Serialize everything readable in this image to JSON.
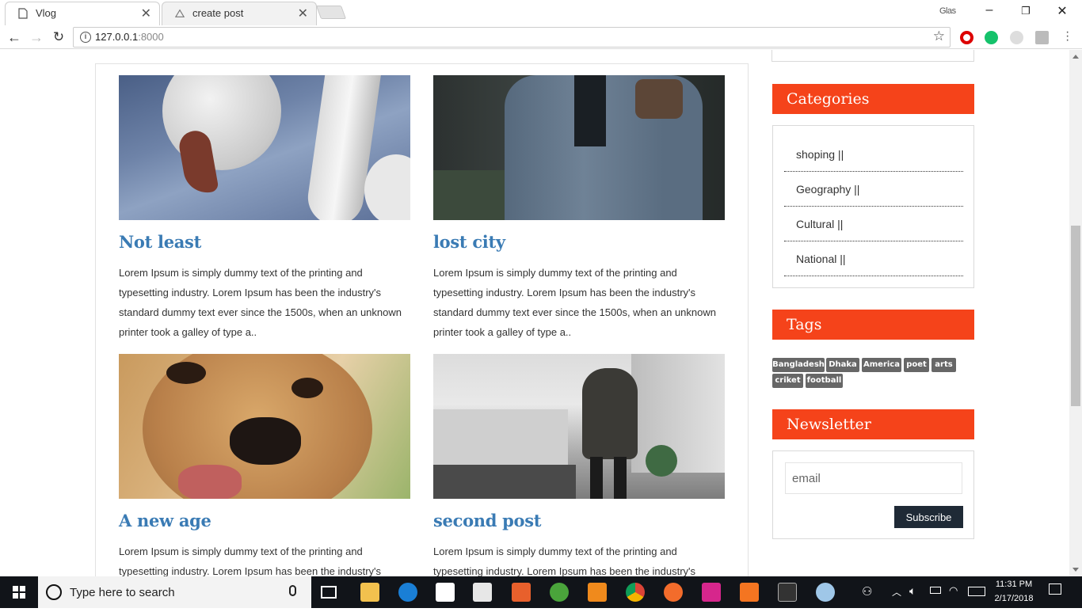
{
  "browser": {
    "tabs": [
      {
        "label": "Vlog",
        "active": true
      },
      {
        "label": "create post",
        "active": false
      }
    ],
    "profile_name": "Glas",
    "url_host": "127.0.0.1",
    "url_port": ":8000"
  },
  "posts": [
    {
      "title": "Not least",
      "image": "swan-photo",
      "excerpt": "Lorem Ipsum is simply dummy text of the printing and typesetting industry. Lorem Ipsum has been the industry's standard dummy text ever since the 1500s, when an unknown printer took a galley of type a.."
    },
    {
      "title": "lost city",
      "image": "jacket-photo",
      "excerpt": "Lorem Ipsum is simply dummy text of the printing and typesetting industry. Lorem Ipsum has been the industry's standard dummy text ever since the 1500s, when an unknown printer took a galley of type a.."
    },
    {
      "title": "A new age",
      "image": "dog-photo",
      "excerpt": "Lorem Ipsum is simply dummy text of the printing and typesetting industry. Lorem Ipsum has been the industry's"
    },
    {
      "title": "second post",
      "image": "street-photo",
      "excerpt": "Lorem Ipsum is simply dummy text of the printing and typesetting industry. Lorem Ipsum has been the industry's"
    }
  ],
  "sidebar": {
    "categories_title": "Categories",
    "categories": [
      "shoping ||",
      "Geography ||",
      "Cultural ||",
      "National ||"
    ],
    "tags_title": "Tags",
    "tags": [
      "Bangladesh",
      "Dhaka",
      "America",
      "poet",
      "arts",
      "criket",
      "football"
    ],
    "newsletter_title": "Newsletter",
    "email_placeholder": "email",
    "subscribe_label": "Subscribe"
  },
  "taskbar": {
    "search_placeholder": "Type here to search",
    "time": "11:31 PM",
    "date": "2/17/2018"
  },
  "colors": {
    "accent": "#f5431a",
    "title_blue": "#3a7bb4",
    "button_dark": "#1f2a36",
    "tag_gray": "#676767"
  }
}
